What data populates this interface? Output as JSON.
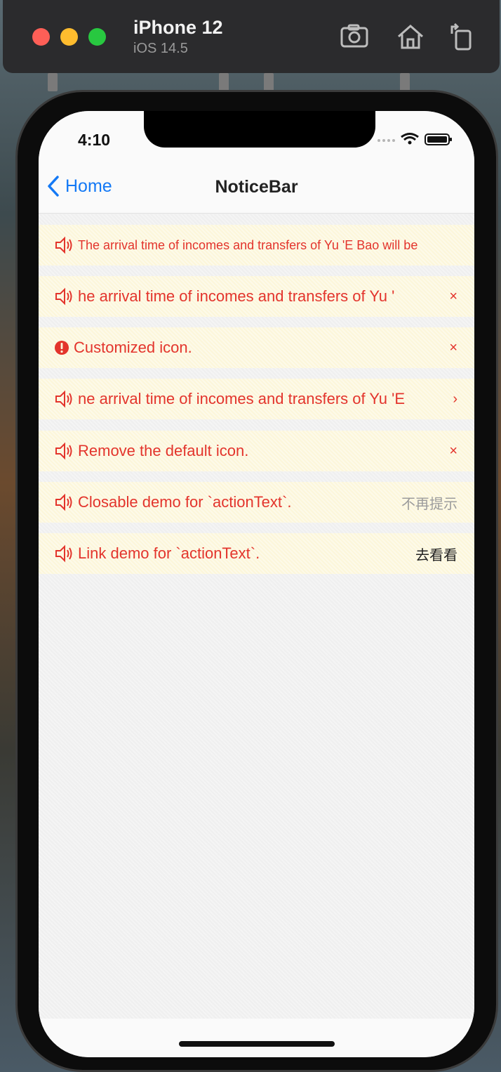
{
  "simulator": {
    "device_name": "iPhone 12",
    "os_version": "iOS 14.5",
    "icons": [
      "screenshot-icon",
      "home-icon",
      "rotate-icon"
    ]
  },
  "status_bar": {
    "time": "4:10",
    "icons": [
      "signal-icon",
      "wifi-icon",
      "battery-icon"
    ]
  },
  "nav": {
    "back_label": "Home",
    "title": "NoticeBar"
  },
  "colors": {
    "accent": "#1479f5",
    "notice_text": "#e3342c",
    "notice_bg": "#fcf6da"
  },
  "notice_bars": [
    {
      "icon": "speaker-icon",
      "text": "The arrival time of incomes and transfers of Yu 'E Bao will be",
      "action": ""
    },
    {
      "icon": "speaker-icon",
      "text": "he arrival time of incomes and transfers of Yu '",
      "action": "×"
    },
    {
      "icon": "exclamation-circle-icon",
      "text": "Customized icon.",
      "action": "×"
    },
    {
      "icon": "speaker-icon",
      "text": "ne arrival time of incomes and transfers of Yu 'E",
      "action": "›"
    },
    {
      "icon": "speaker-icon",
      "text": "Remove the default icon.",
      "action": "×"
    },
    {
      "icon": "speaker-icon",
      "text": "Closable demo for `actionText`.",
      "action": "不再提示"
    },
    {
      "icon": "speaker-icon",
      "text": "Link demo for `actionText`.",
      "action": "去看看"
    }
  ]
}
